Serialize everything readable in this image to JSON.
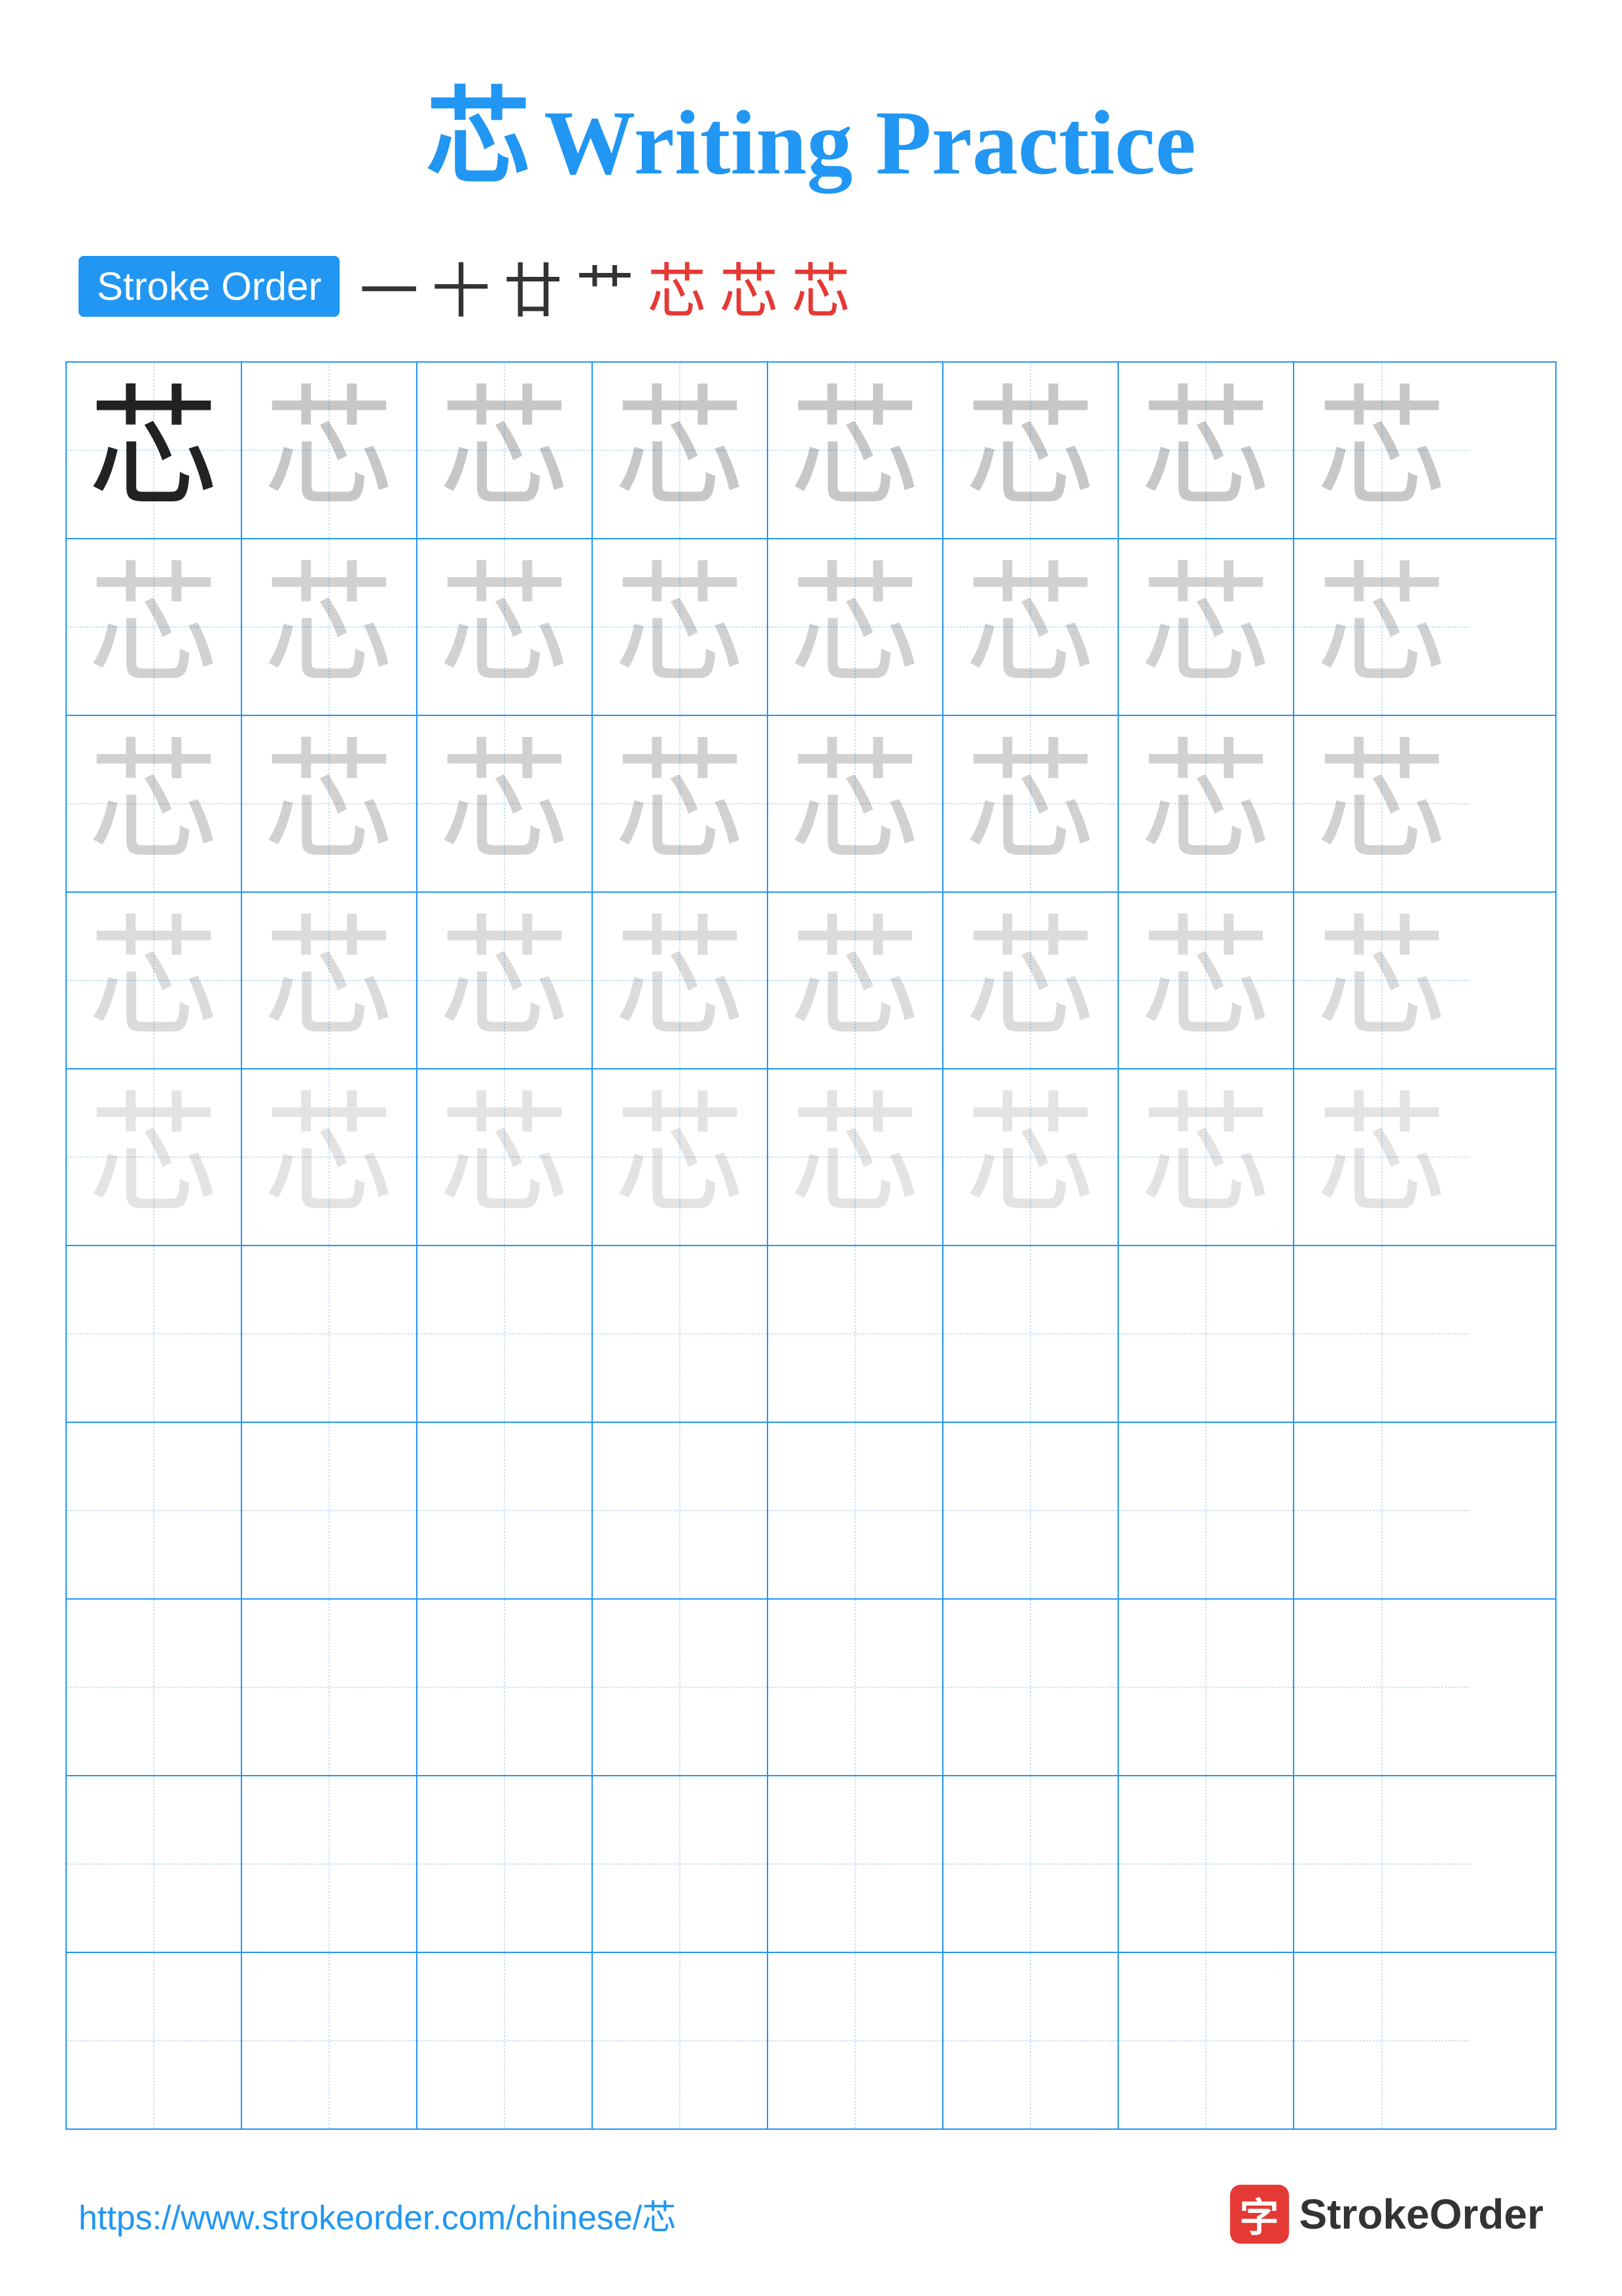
{
  "page": {
    "title_char": "芯",
    "title_text": "Writing Practice"
  },
  "stroke_order": {
    "badge_label": "Stroke Order",
    "strokes": [
      "一",
      "十",
      "廿",
      "艹̃",
      "芯",
      "芯",
      "芯"
    ]
  },
  "grid": {
    "char": "芯",
    "rows": 10,
    "cols": 8
  },
  "footer": {
    "url": "https://www.strokeorder.com/chinese/芯",
    "brand_char": "字",
    "brand_name": "StrokeOrder"
  }
}
